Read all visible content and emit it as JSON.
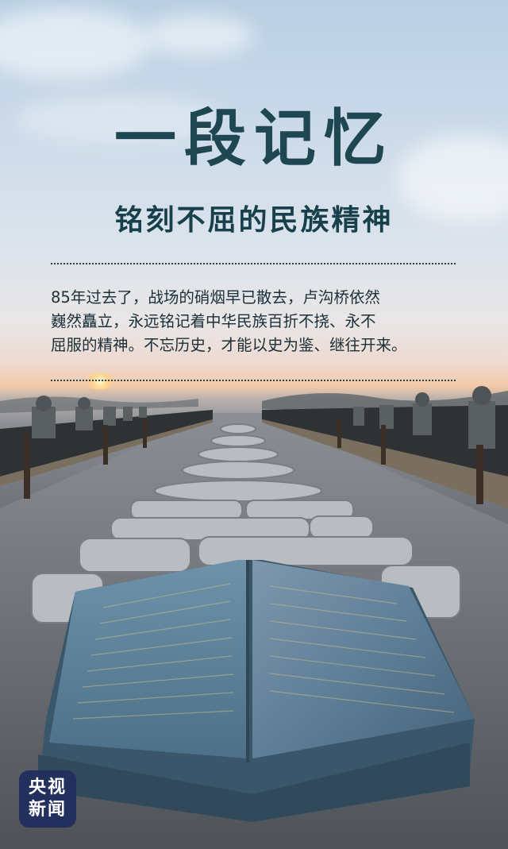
{
  "poster": {
    "title": "一段记忆",
    "subtitle": "铭刻不屈的民族精神",
    "paragraph_lines": [
      "85年过去了，战场的硝烟早已散去，卢沟桥依然",
      "巍然矗立，永远铭记着中华民族百折不挠、永不",
      "屈服的精神。不忘历史，才能以史为鉴、继往开来。"
    ]
  },
  "logo": {
    "line1": "央视",
    "line2": "新闻"
  },
  "colors": {
    "title": "#1f4752",
    "subtitle": "#17404b",
    "body_text": "#1b2f38",
    "logo_bg": "#232f5c"
  }
}
